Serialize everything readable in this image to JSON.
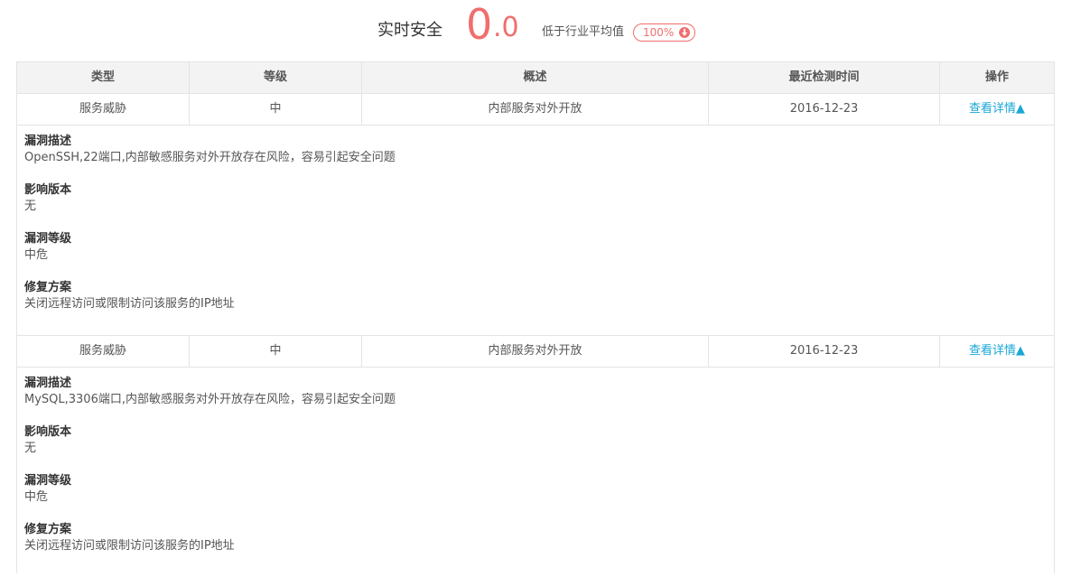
{
  "score": {
    "label": "实时安全",
    "int_part": "0",
    "dec_part": ".0",
    "compare_text": "低于行业平均值",
    "badge_pct": "100%",
    "accent": "#f06e6e",
    "badge_icon": "arrow-down-circle-icon"
  },
  "table": {
    "headers": [
      "类型",
      "等级",
      "概述",
      "最近检测时间",
      "操作"
    ],
    "link_color": "#1aa7d6",
    "rows": [
      {
        "type": "服务威胁",
        "level": "中",
        "summary": "内部服务对外开放",
        "time": "2016-12-23",
        "action": "查看详情▲",
        "details": [
          {
            "title": "漏洞描述",
            "value": "OpenSSH,22端口,内部敏感服务对外开放存在风险，容易引起安全问题"
          },
          {
            "title": "影响版本",
            "value": "无"
          },
          {
            "title": "漏洞等级",
            "value": "中危"
          },
          {
            "title": "修复方案",
            "value": "关闭远程访问或限制访问该服务的IP地址"
          }
        ]
      },
      {
        "type": "服务威胁",
        "level": "中",
        "summary": "内部服务对外开放",
        "time": "2016-12-23",
        "action": "查看详情▲",
        "details": [
          {
            "title": "漏洞描述",
            "value": "MySQL,3306端口,内部敏感服务对外开放存在风险，容易引起安全问题"
          },
          {
            "title": "影响版本",
            "value": "无"
          },
          {
            "title": "漏洞等级",
            "value": "中危"
          },
          {
            "title": "修复方案",
            "value": "关闭远程访问或限制访问该服务的IP地址"
          }
        ]
      }
    ]
  }
}
